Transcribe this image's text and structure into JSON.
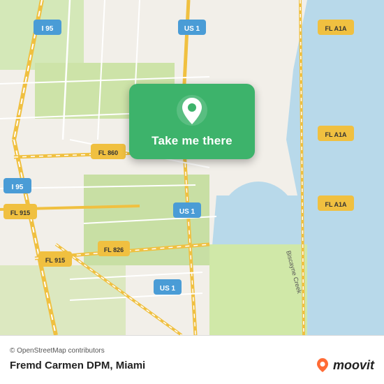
{
  "map": {
    "attribution": "© OpenStreetMap contributors",
    "colors": {
      "land": "#f2efe9",
      "water": "#a8d4e6",
      "road_major": "#f7c96e",
      "road_highway": "#f7c96e",
      "road_minor": "#ffffff",
      "green_area": "#c8dfa4",
      "highway_label_bg": "#f7c96e",
      "highway_label_text": "#333"
    },
    "labels": [
      {
        "id": "i95_top",
        "text": "I 95"
      },
      {
        "id": "us1_top",
        "text": "US 1"
      },
      {
        "id": "fla1a_top_right",
        "text": "FL A1A"
      },
      {
        "id": "fla1a_mid_right",
        "text": "FL A1A"
      },
      {
        "id": "fla1a_bot_right",
        "text": "FL A1A"
      },
      {
        "id": "i95_left",
        "text": "I 95"
      },
      {
        "id": "fl860",
        "text": "FL 860"
      },
      {
        "id": "fl915_1",
        "text": "FL 915"
      },
      {
        "id": "fl915_2",
        "text": "FL 915"
      },
      {
        "id": "fl826",
        "text": "FL 826"
      },
      {
        "id": "us1_mid",
        "text": "US 1"
      },
      {
        "id": "us1_bot",
        "text": "US 1"
      },
      {
        "id": "biscayne_creek",
        "text": "Biscayne Creek"
      }
    ]
  },
  "card": {
    "button_label": "Take me there",
    "pin_color": "#ffffff"
  },
  "footer": {
    "attribution": "© OpenStreetMap contributors",
    "location_name": "Fremd Carmen DPM, Miami"
  },
  "moovit": {
    "logo_text": "moovit"
  }
}
